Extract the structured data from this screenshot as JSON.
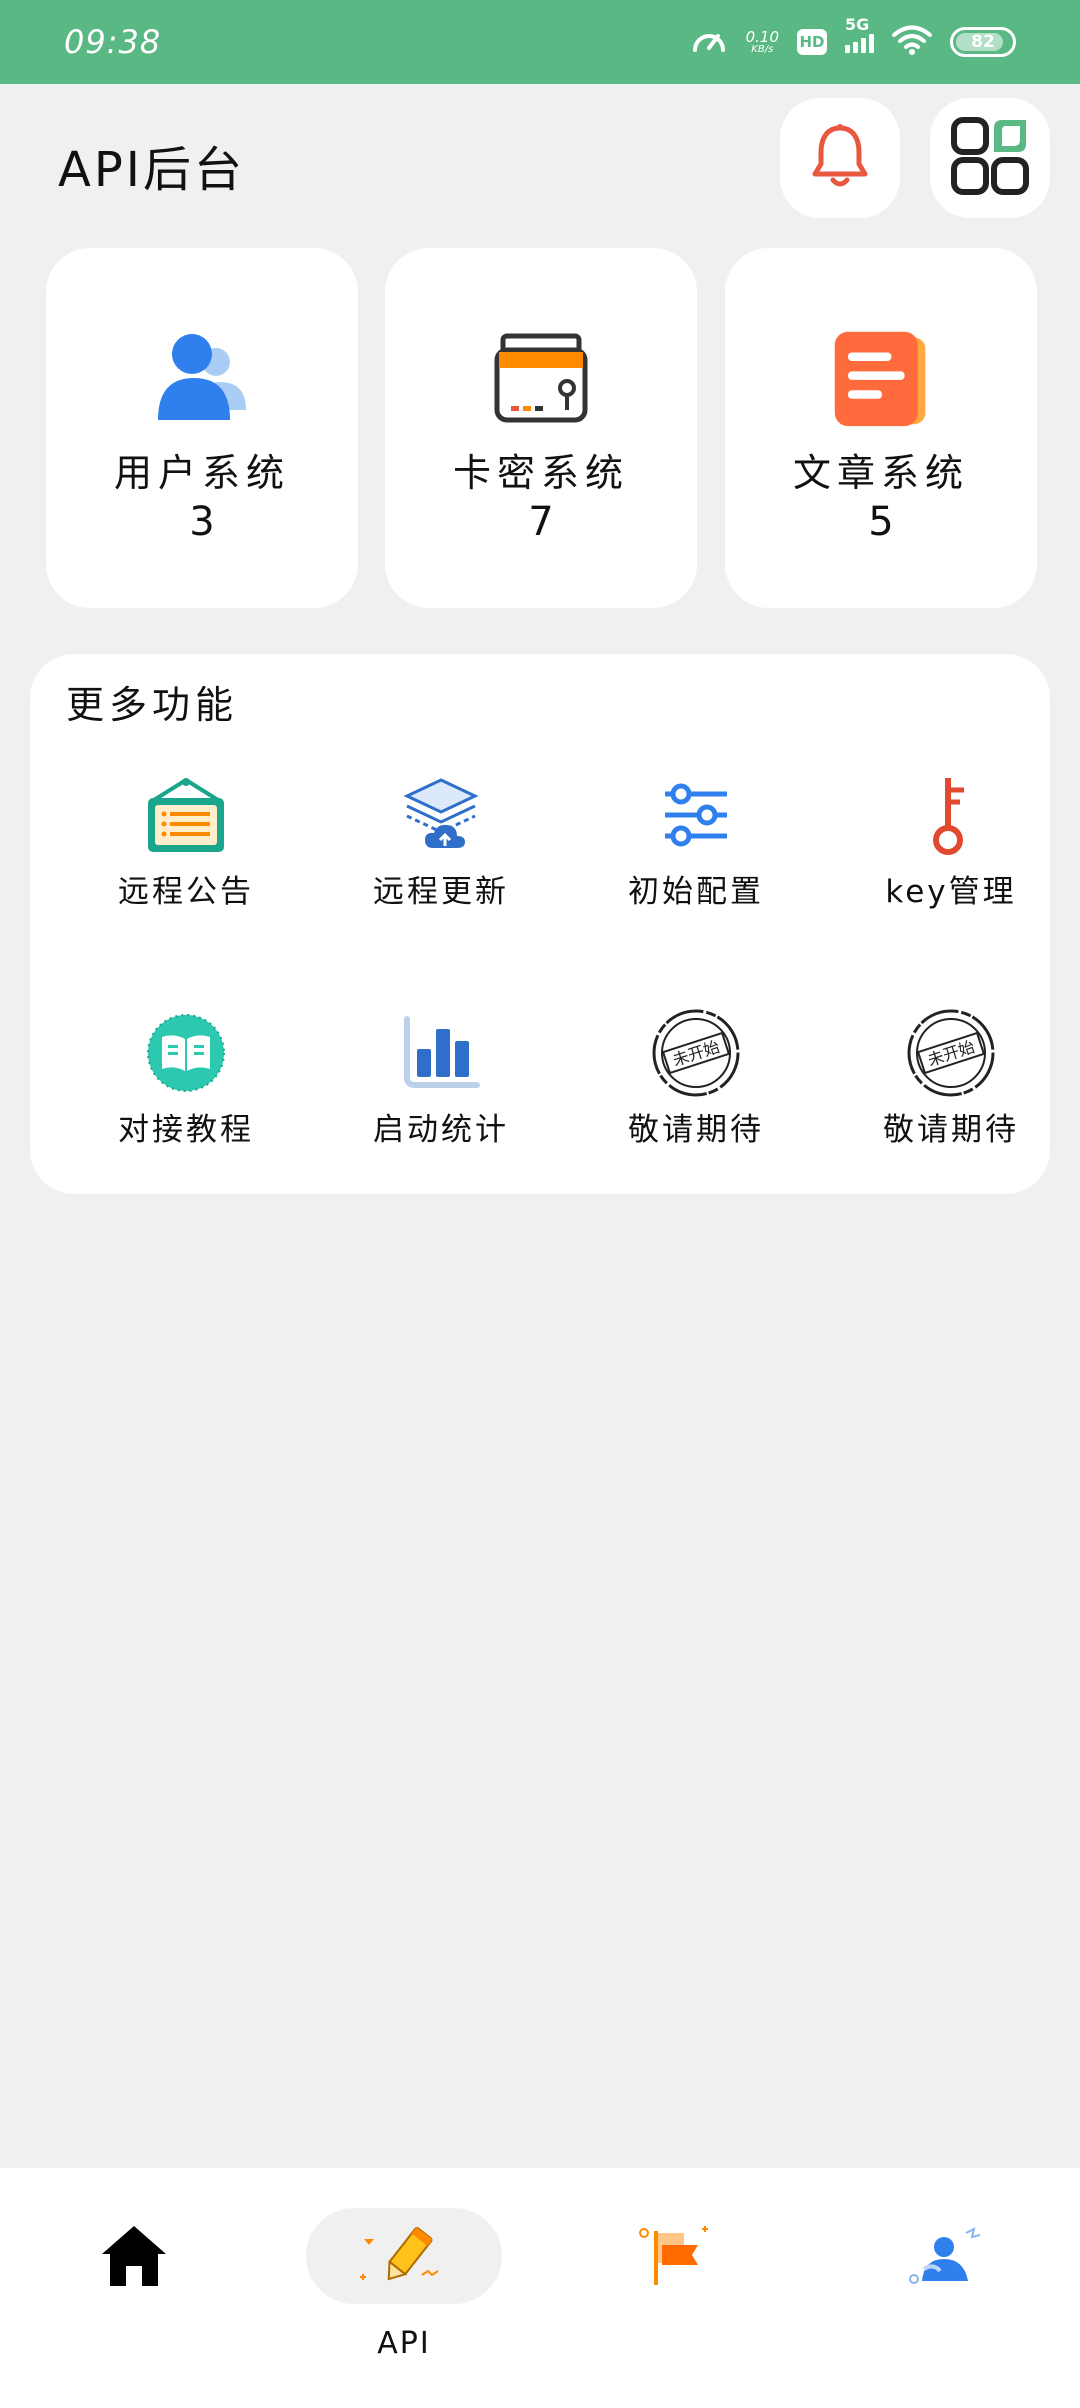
{
  "status_bar": {
    "time": "09:38",
    "net_speed_value": "0.10",
    "net_speed_unit": "KB/s",
    "hd_label": "HD",
    "network_label": "5G",
    "battery_level": "82",
    "icons": [
      "speedometer-icon",
      "hd-icon",
      "signal-5g-icon",
      "wifi-icon",
      "battery-icon"
    ]
  },
  "header": {
    "title": "API后台",
    "bell_icon": "bell-icon",
    "apps_icon": "apps-grid-icon",
    "accent_red": "#e9573f"
  },
  "stats": [
    {
      "label": "用户系统",
      "count": "3",
      "icon": "users-icon"
    },
    {
      "label": "卡密系统",
      "count": "7",
      "icon": "safe-card-icon"
    },
    {
      "label": "文章系统",
      "count": "5",
      "icon": "article-icon"
    }
  ],
  "more": {
    "title": "更多功能",
    "items": [
      {
        "label": "远程公告",
        "icon": "announcement-board-icon"
      },
      {
        "label": "远程更新",
        "icon": "cloud-update-icon"
      },
      {
        "label": "初始配置",
        "icon": "sliders-icon"
      },
      {
        "label": "key管理",
        "icon": "key-icon"
      },
      {
        "label": "对接教程",
        "icon": "book-icon"
      },
      {
        "label": "启动统计",
        "icon": "bar-chart-icon"
      },
      {
        "label": "敬请期待",
        "icon": "not-started-stamp-icon",
        "stamp": "未开始"
      },
      {
        "label": "敬请期待",
        "icon": "not-started-stamp-icon",
        "stamp": "未开始"
      }
    ]
  },
  "bottom_nav": {
    "items": [
      {
        "label": "",
        "icon": "home-icon",
        "active": false
      },
      {
        "label": "API",
        "icon": "pencil-icon",
        "active": true
      },
      {
        "label": "",
        "icon": "flag-icon",
        "active": false
      },
      {
        "label": "",
        "icon": "user-profile-icon",
        "active": false
      }
    ]
  },
  "colors": {
    "status_bar": "#5ab884",
    "background": "#f0f0f0",
    "blue": "#2f80ed",
    "orange": "#ff8a00",
    "red_orange": "#ff6b3d",
    "teal": "#1aa58d"
  }
}
